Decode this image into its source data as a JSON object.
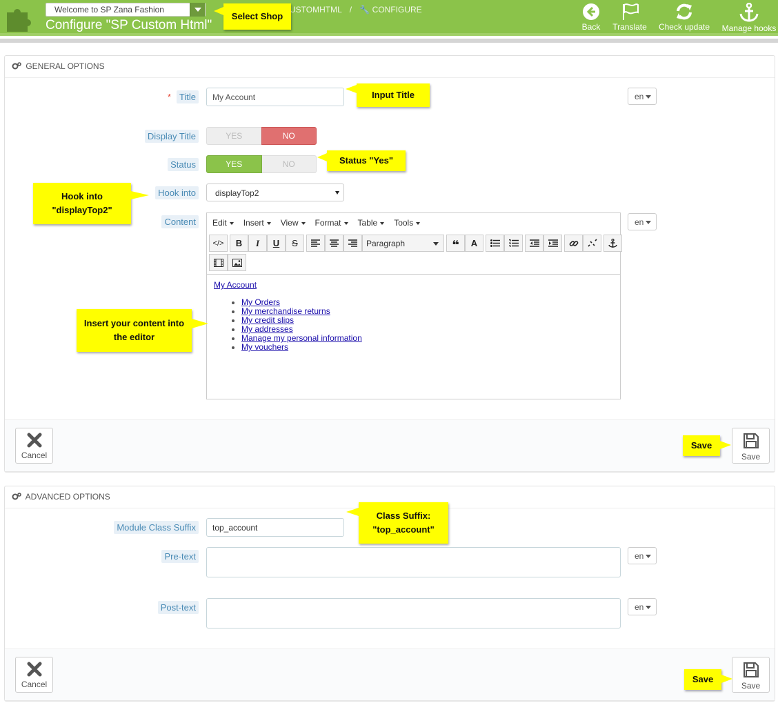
{
  "header": {
    "shop_select_value": "Welcome to SP Zana Fashion",
    "page_title": "Configure \"SP Custom Html\"",
    "breadcrumb": [
      "USTOMHTML",
      "CONFIGURE"
    ],
    "toolbar": {
      "back": "Back",
      "translate": "Translate",
      "check_update": "Check update",
      "manage_hooks": "Manage hooks"
    }
  },
  "callouts": {
    "select_shop": "Select Shop",
    "input_title": "Input Title",
    "status_yes": "Status \"Yes\"",
    "hook_into": "Hook into \"displayTop2\"",
    "insert_content": "Insert your content into the editor",
    "save_1": "Save",
    "class_suffix": "Class Suffix: \"top_account\"",
    "save_2": "Save"
  },
  "general": {
    "heading": "GENERAL OPTIONS",
    "title_label": "Title",
    "title_value": "My Account",
    "lang": "en",
    "display_title_label": "Display Title",
    "status_label": "Status",
    "yes": "YES",
    "no": "NO",
    "display_title_state": "NO",
    "status_state": "YES",
    "hook_label": "Hook into",
    "hook_value": "displayTop2",
    "content_label": "Content",
    "editor_menu": [
      "Edit",
      "Insert",
      "View",
      "Format",
      "Table",
      "Tools"
    ],
    "paragraph_select": "Paragraph",
    "content_heading_link": "My Account",
    "content_links": [
      "My Orders",
      "My merchandise returns",
      "My credit slips",
      "My addresses",
      "Manage my personal information",
      "My vouchers"
    ],
    "cancel": "Cancel",
    "save": "Save"
  },
  "advanced": {
    "heading": "ADVANCED OPTIONS",
    "suffix_label": "Module Class Suffix",
    "suffix_value": "top_account",
    "pretext_label": "Pre-text",
    "posttext_label": "Post-text",
    "lang": "en",
    "cancel": "Cancel",
    "save": "Save"
  },
  "colors": {
    "header_green": "#8bc34a",
    "switch_yes": "#8bc34a",
    "switch_no": "#e57373",
    "callout": "#ffff00"
  }
}
